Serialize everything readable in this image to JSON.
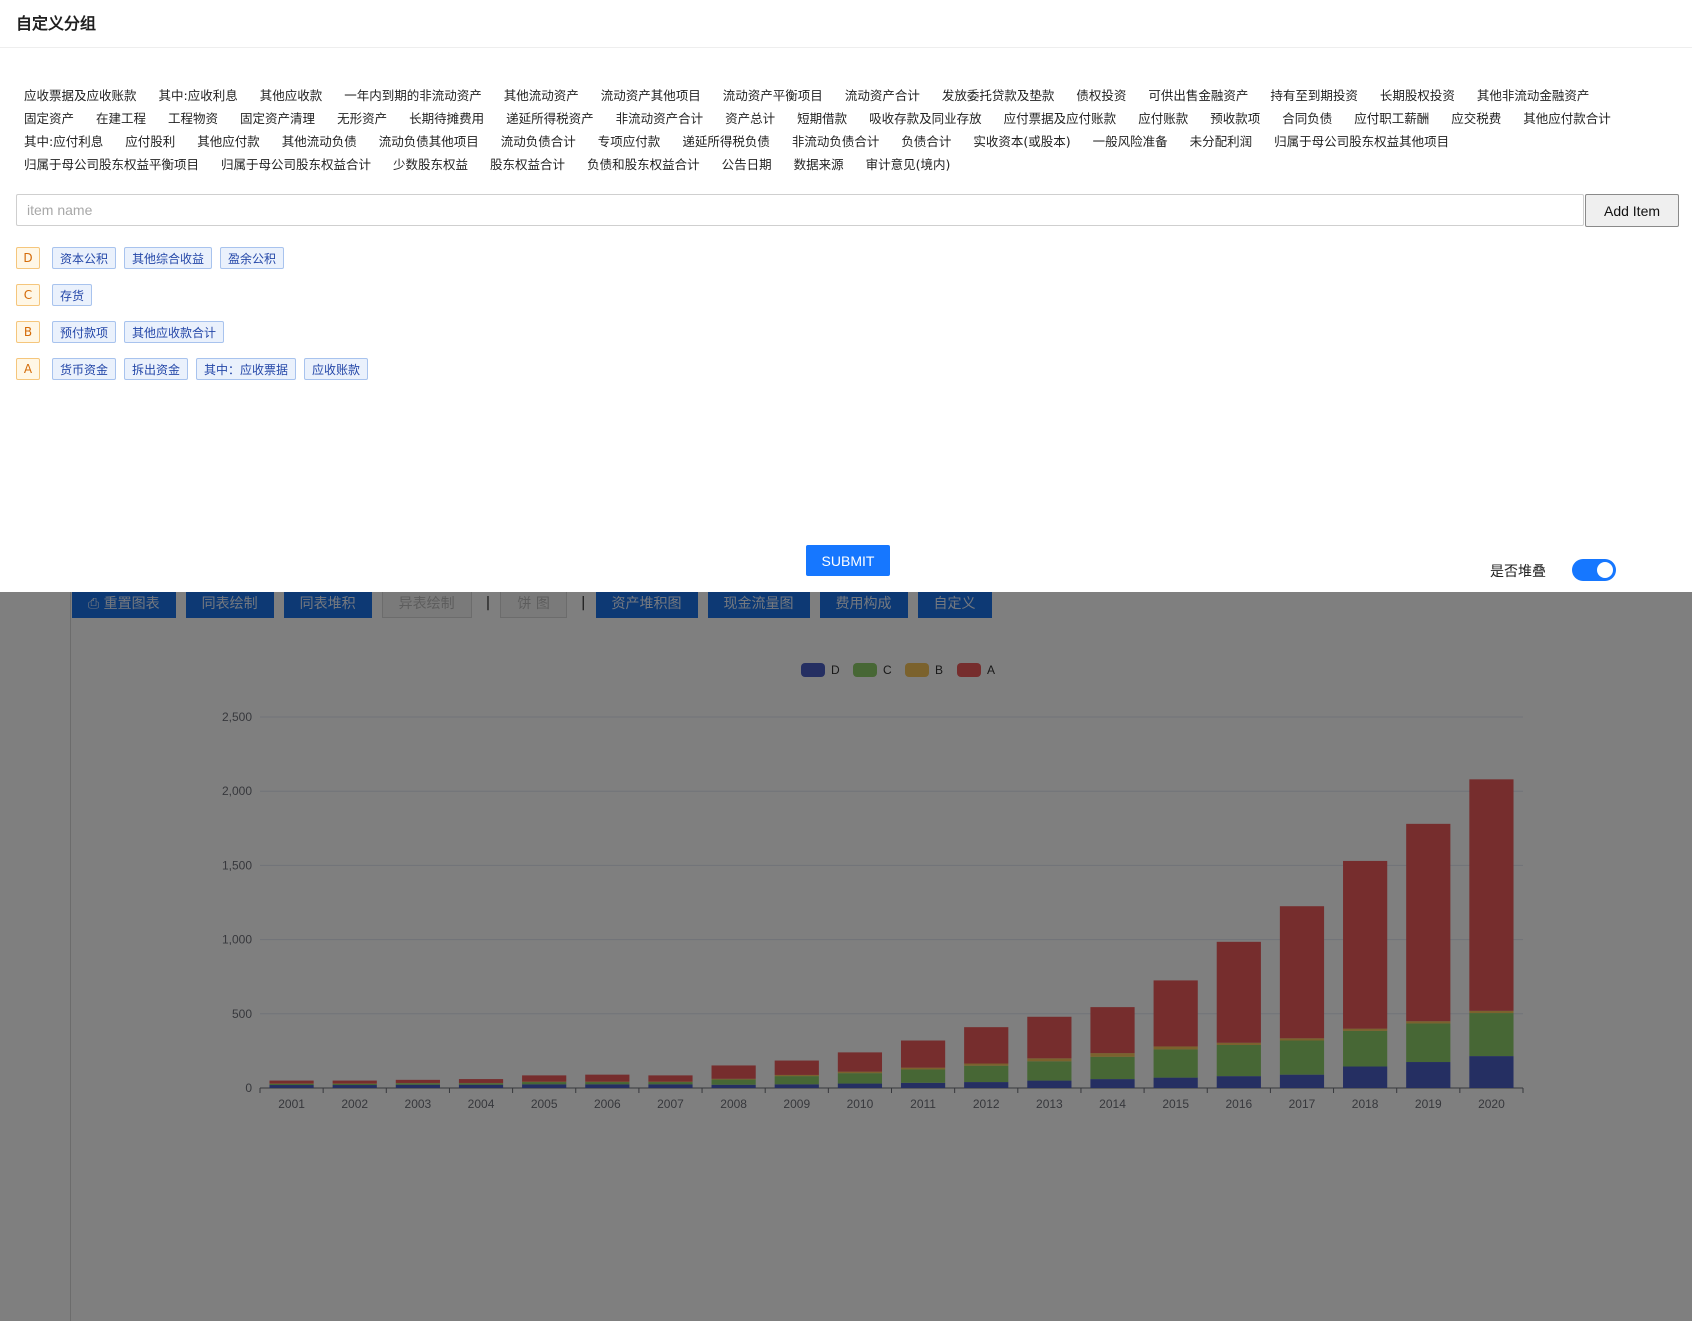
{
  "modal": {
    "title": "自定义分组",
    "fields": [
      "应收票据及应收账款",
      "其中:应收利息",
      "其他应收款",
      "一年内到期的非流动资产",
      "其他流动资产",
      "流动资产其他项目",
      "流动资产平衡项目",
      "流动资产合计",
      "发放委托贷款及垫款",
      "债权投资",
      "可供出售金融资产",
      "持有至到期投资",
      "长期股权投资",
      "其他非流动金融资产",
      "固定资产",
      "在建工程",
      "工程物资",
      "固定资产清理",
      "无形资产",
      "长期待摊费用",
      "递延所得税资产",
      "非流动资产合计",
      "资产总计",
      "短期借款",
      "吸收存款及同业存放",
      "应付票据及应付账款",
      "应付账款",
      "预收款项",
      "合同负债",
      "应付职工薪酬",
      "应交税费",
      "其他应付款合计",
      "其中:应付利息",
      "应付股利",
      "其他应付款",
      "其他流动负债",
      "流动负债其他项目",
      "流动负债合计",
      "专项应付款",
      "递延所得税负债",
      "非流动负债合计",
      "负债合计",
      "实收资本(或股本)",
      "一般风险准备",
      "未分配利润",
      "归属于母公司股东权益其他项目",
      "归属于母公司股东权益平衡项目",
      "归属于母公司股东权益合计",
      "少数股东权益",
      "股东权益合计",
      "负债和股东权益合计",
      "公告日期",
      "数据来源",
      "审计意见(境内)"
    ],
    "input_placeholder": "item name",
    "add_item_label": "Add Item",
    "groups": [
      {
        "label": "D",
        "items": [
          "资本公积",
          "其他综合收益",
          "盈余公积"
        ]
      },
      {
        "label": "C",
        "items": [
          "存货"
        ]
      },
      {
        "label": "B",
        "items": [
          "预付款项",
          "其他应收款合计"
        ]
      },
      {
        "label": "A",
        "items": [
          "货币资金",
          "拆出资金",
          "其中：应收票据",
          "应收账款"
        ]
      }
    ],
    "submit_label": "SUBMIT",
    "stack_label": "是否堆叠",
    "stack_enabled": true
  },
  "toolbar": {
    "buttons": [
      {
        "label": "⎙ 重置图表",
        "disabled": false
      },
      {
        "label": "同表绘制",
        "disabled": false
      },
      {
        "label": "同表堆积",
        "disabled": false
      },
      {
        "label": "异表绘制",
        "disabled": true
      },
      {
        "sep": "|"
      },
      {
        "label": "饼 图",
        "disabled": true
      },
      {
        "sep": "|"
      },
      {
        "label": "资产堆积图",
        "disabled": false
      },
      {
        "label": "现金流量图",
        "disabled": false
      },
      {
        "label": "费用构成",
        "disabled": false
      },
      {
        "label": "自定义",
        "disabled": false
      }
    ]
  },
  "colors": {
    "D": "#4b5fc4",
    "C": "#8fcf6a",
    "B": "#f6c45a",
    "A": "#ec5b5b",
    "accent": "#1677ff"
  },
  "chart_data": {
    "type": "bar",
    "stacked": true,
    "categories": [
      "2001",
      "2002",
      "2003",
      "2004",
      "2005",
      "2006",
      "2007",
      "2008",
      "2009",
      "2010",
      "2011",
      "2012",
      "2013",
      "2014",
      "2015",
      "2016",
      "2017",
      "2018",
      "2019",
      "2020"
    ],
    "series": [
      {
        "name": "D",
        "values": [
          20,
          20,
          22,
          22,
          25,
          25,
          25,
          22,
          25,
          30,
          35,
          40,
          50,
          60,
          70,
          80,
          90,
          145,
          175,
          215
        ]
      },
      {
        "name": "C",
        "values": [
          8,
          8,
          10,
          10,
          15,
          15,
          15,
          35,
          55,
          70,
          90,
          110,
          130,
          150,
          190,
          210,
          230,
          240,
          260,
          290
        ]
      },
      {
        "name": "B",
        "values": [
          2,
          2,
          2,
          2,
          3,
          3,
          3,
          5,
          8,
          10,
          12,
          15,
          20,
          25,
          20,
          15,
          15,
          15,
          15,
          15
        ]
      },
      {
        "name": "A",
        "values": [
          20,
          20,
          21,
          26,
          42,
          47,
          42,
          90,
          97,
          130,
          183,
          245,
          280,
          310,
          445,
          680,
          890,
          1130,
          1330,
          1560
        ]
      }
    ],
    "ylim": [
      0,
      2500
    ],
    "yticks": [
      "0",
      "500",
      "1,000",
      "1,500",
      "2,000",
      "2,500"
    ],
    "legend": [
      "D",
      "C",
      "B",
      "A"
    ],
    "legend_position": "top-center",
    "grid": true,
    "toolbox_icons": [
      "download-icon",
      "line-chart-icon",
      "bar-chart-icon"
    ]
  }
}
